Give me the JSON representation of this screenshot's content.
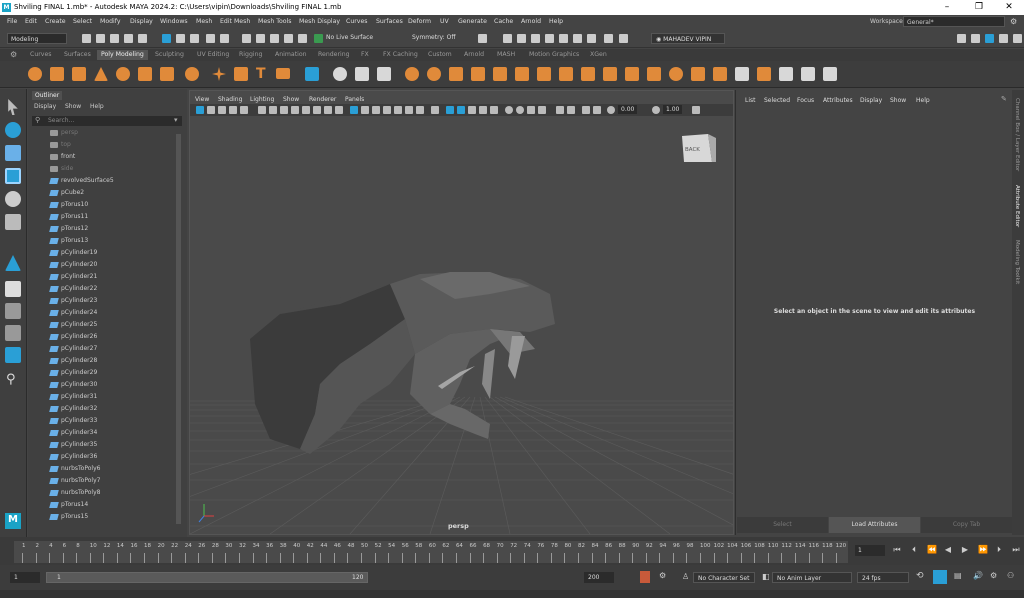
{
  "window": {
    "title": "Shviling FINAL 1.mb* - Autodesk MAYA 2024.2: C:\\Users\\vipin\\Downloads\\Shviling FINAL 1.mb",
    "minimize": "–",
    "maximize": "❐",
    "close": "✕"
  },
  "menubar": {
    "items": [
      "File",
      "Edit",
      "Create",
      "Select",
      "Modify",
      "Display",
      "Windows",
      "Mesh",
      "Edit Mesh",
      "Mesh Tools",
      "Mesh Display",
      "Curves",
      "Surfaces",
      "Deform",
      "UV",
      "Generate",
      "Cache",
      "Arnold",
      "Help"
    ],
    "workspace_label": "Workspace:",
    "workspace_value": "General*"
  },
  "status": {
    "mode": "Modeling",
    "live_surface": "No Live Surface",
    "symmetry": "Symmetry: Off",
    "user": "MAHADEV VIPIN"
  },
  "shelf_tabs": {
    "items": [
      "Curves",
      "Surfaces",
      "Poly Modeling",
      "Sculpting",
      "UV Editing",
      "Rigging",
      "Animation",
      "Rendering",
      "FX",
      "FX Caching",
      "Custom",
      "Arnold",
      "MASH",
      "Motion Graphics",
      "XGen"
    ],
    "active": "Poly Modeling"
  },
  "outliner": {
    "tab": "Outliner",
    "menu": [
      "Display",
      "Show",
      "Help"
    ],
    "search_placeholder": "Search...",
    "items": [
      {
        "name": "persp",
        "icon": "camera",
        "dim": true
      },
      {
        "name": "top",
        "icon": "camera",
        "dim": true
      },
      {
        "name": "front",
        "icon": "camera",
        "dim": false
      },
      {
        "name": "side",
        "icon": "camera",
        "dim": true
      },
      {
        "name": "revolvedSurface5",
        "icon": "surface",
        "dim": false
      },
      {
        "name": "pCube2",
        "icon": "mesh",
        "dim": false
      },
      {
        "name": "pTorus10",
        "icon": "mesh",
        "dim": false
      },
      {
        "name": "pTorus11",
        "icon": "mesh",
        "dim": false
      },
      {
        "name": "pTorus12",
        "icon": "mesh",
        "dim": false
      },
      {
        "name": "pTorus13",
        "icon": "mesh",
        "dim": false
      },
      {
        "name": "pCylinder19",
        "icon": "mesh",
        "dim": false
      },
      {
        "name": "pCylinder20",
        "icon": "mesh",
        "dim": false
      },
      {
        "name": "pCylinder21",
        "icon": "mesh",
        "dim": false
      },
      {
        "name": "pCylinder22",
        "icon": "mesh",
        "dim": false
      },
      {
        "name": "pCylinder23",
        "icon": "mesh",
        "dim": false
      },
      {
        "name": "pCylinder24",
        "icon": "mesh",
        "dim": false
      },
      {
        "name": "pCylinder25",
        "icon": "mesh",
        "dim": false
      },
      {
        "name": "pCylinder26",
        "icon": "mesh",
        "dim": false
      },
      {
        "name": "pCylinder27",
        "icon": "mesh",
        "dim": false
      },
      {
        "name": "pCylinder28",
        "icon": "mesh",
        "dim": false
      },
      {
        "name": "pCylinder29",
        "icon": "mesh",
        "dim": false
      },
      {
        "name": "pCylinder30",
        "icon": "mesh",
        "dim": false
      },
      {
        "name": "pCylinder31",
        "icon": "mesh",
        "dim": false
      },
      {
        "name": "pCylinder32",
        "icon": "mesh",
        "dim": false
      },
      {
        "name": "pCylinder33",
        "icon": "mesh",
        "dim": false
      },
      {
        "name": "pCylinder34",
        "icon": "mesh",
        "dim": false
      },
      {
        "name": "pCylinder35",
        "icon": "mesh",
        "dim": false
      },
      {
        "name": "pCylinder36",
        "icon": "mesh",
        "dim": false
      },
      {
        "name": "nurbsToPoly6",
        "icon": "mesh",
        "dim": false
      },
      {
        "name": "nurbsToPoly7",
        "icon": "mesh",
        "dim": false
      },
      {
        "name": "nurbsToPoly8",
        "icon": "mesh",
        "dim": false
      },
      {
        "name": "pTorus14",
        "icon": "mesh",
        "dim": false
      },
      {
        "name": "pTorus15",
        "icon": "mesh",
        "dim": false
      }
    ]
  },
  "viewport": {
    "menu": [
      "View",
      "Shading",
      "Lighting",
      "Show",
      "Renderer",
      "Panels"
    ],
    "exposure": "0.00",
    "gamma": "1.00",
    "camera_label": "persp",
    "viewcube_label": "BACK"
  },
  "attribute_editor": {
    "menu": [
      "List",
      "Selected",
      "Focus",
      "Attributes",
      "Display",
      "Show",
      "Help"
    ],
    "message": "Select an object in the scene to view and edit its attributes",
    "buttons": [
      "Select",
      "Load Attributes",
      "Copy Tab"
    ]
  },
  "side_tabs": [
    "Channel Box / Layer Editor",
    "Attribute Editor",
    "Modeling Toolkit"
  ],
  "timeline": {
    "ticks": [
      "1",
      "2",
      "4",
      "6",
      "8",
      "10",
      "12",
      "14",
      "16",
      "18",
      "20",
      "22",
      "24",
      "26",
      "28",
      "30",
      "32",
      "34",
      "36",
      "38",
      "40",
      "42",
      "44",
      "46",
      "48",
      "50",
      "52",
      "54",
      "56",
      "58",
      "60",
      "62",
      "64",
      "66",
      "68",
      "70",
      "72",
      "74",
      "76",
      "78",
      "80",
      "82",
      "84",
      "86",
      "88",
      "90",
      "92",
      "94",
      "96",
      "98",
      "100",
      "102",
      "104",
      "106",
      "108",
      "110",
      "112",
      "114",
      "116",
      "118",
      "120"
    ],
    "current_frame": "1"
  },
  "range": {
    "start": "1",
    "range_start": "1",
    "range_end": "120",
    "end": "200",
    "character_set": "No Character Set",
    "anim_layer": "No Anim Layer",
    "fps": "24 fps"
  },
  "colors": {
    "accent": "#2a9fd6",
    "shelf_orange": "#e08a3a",
    "viewport_bg": "#4a4a4a",
    "grid": "#5e5e5e"
  }
}
